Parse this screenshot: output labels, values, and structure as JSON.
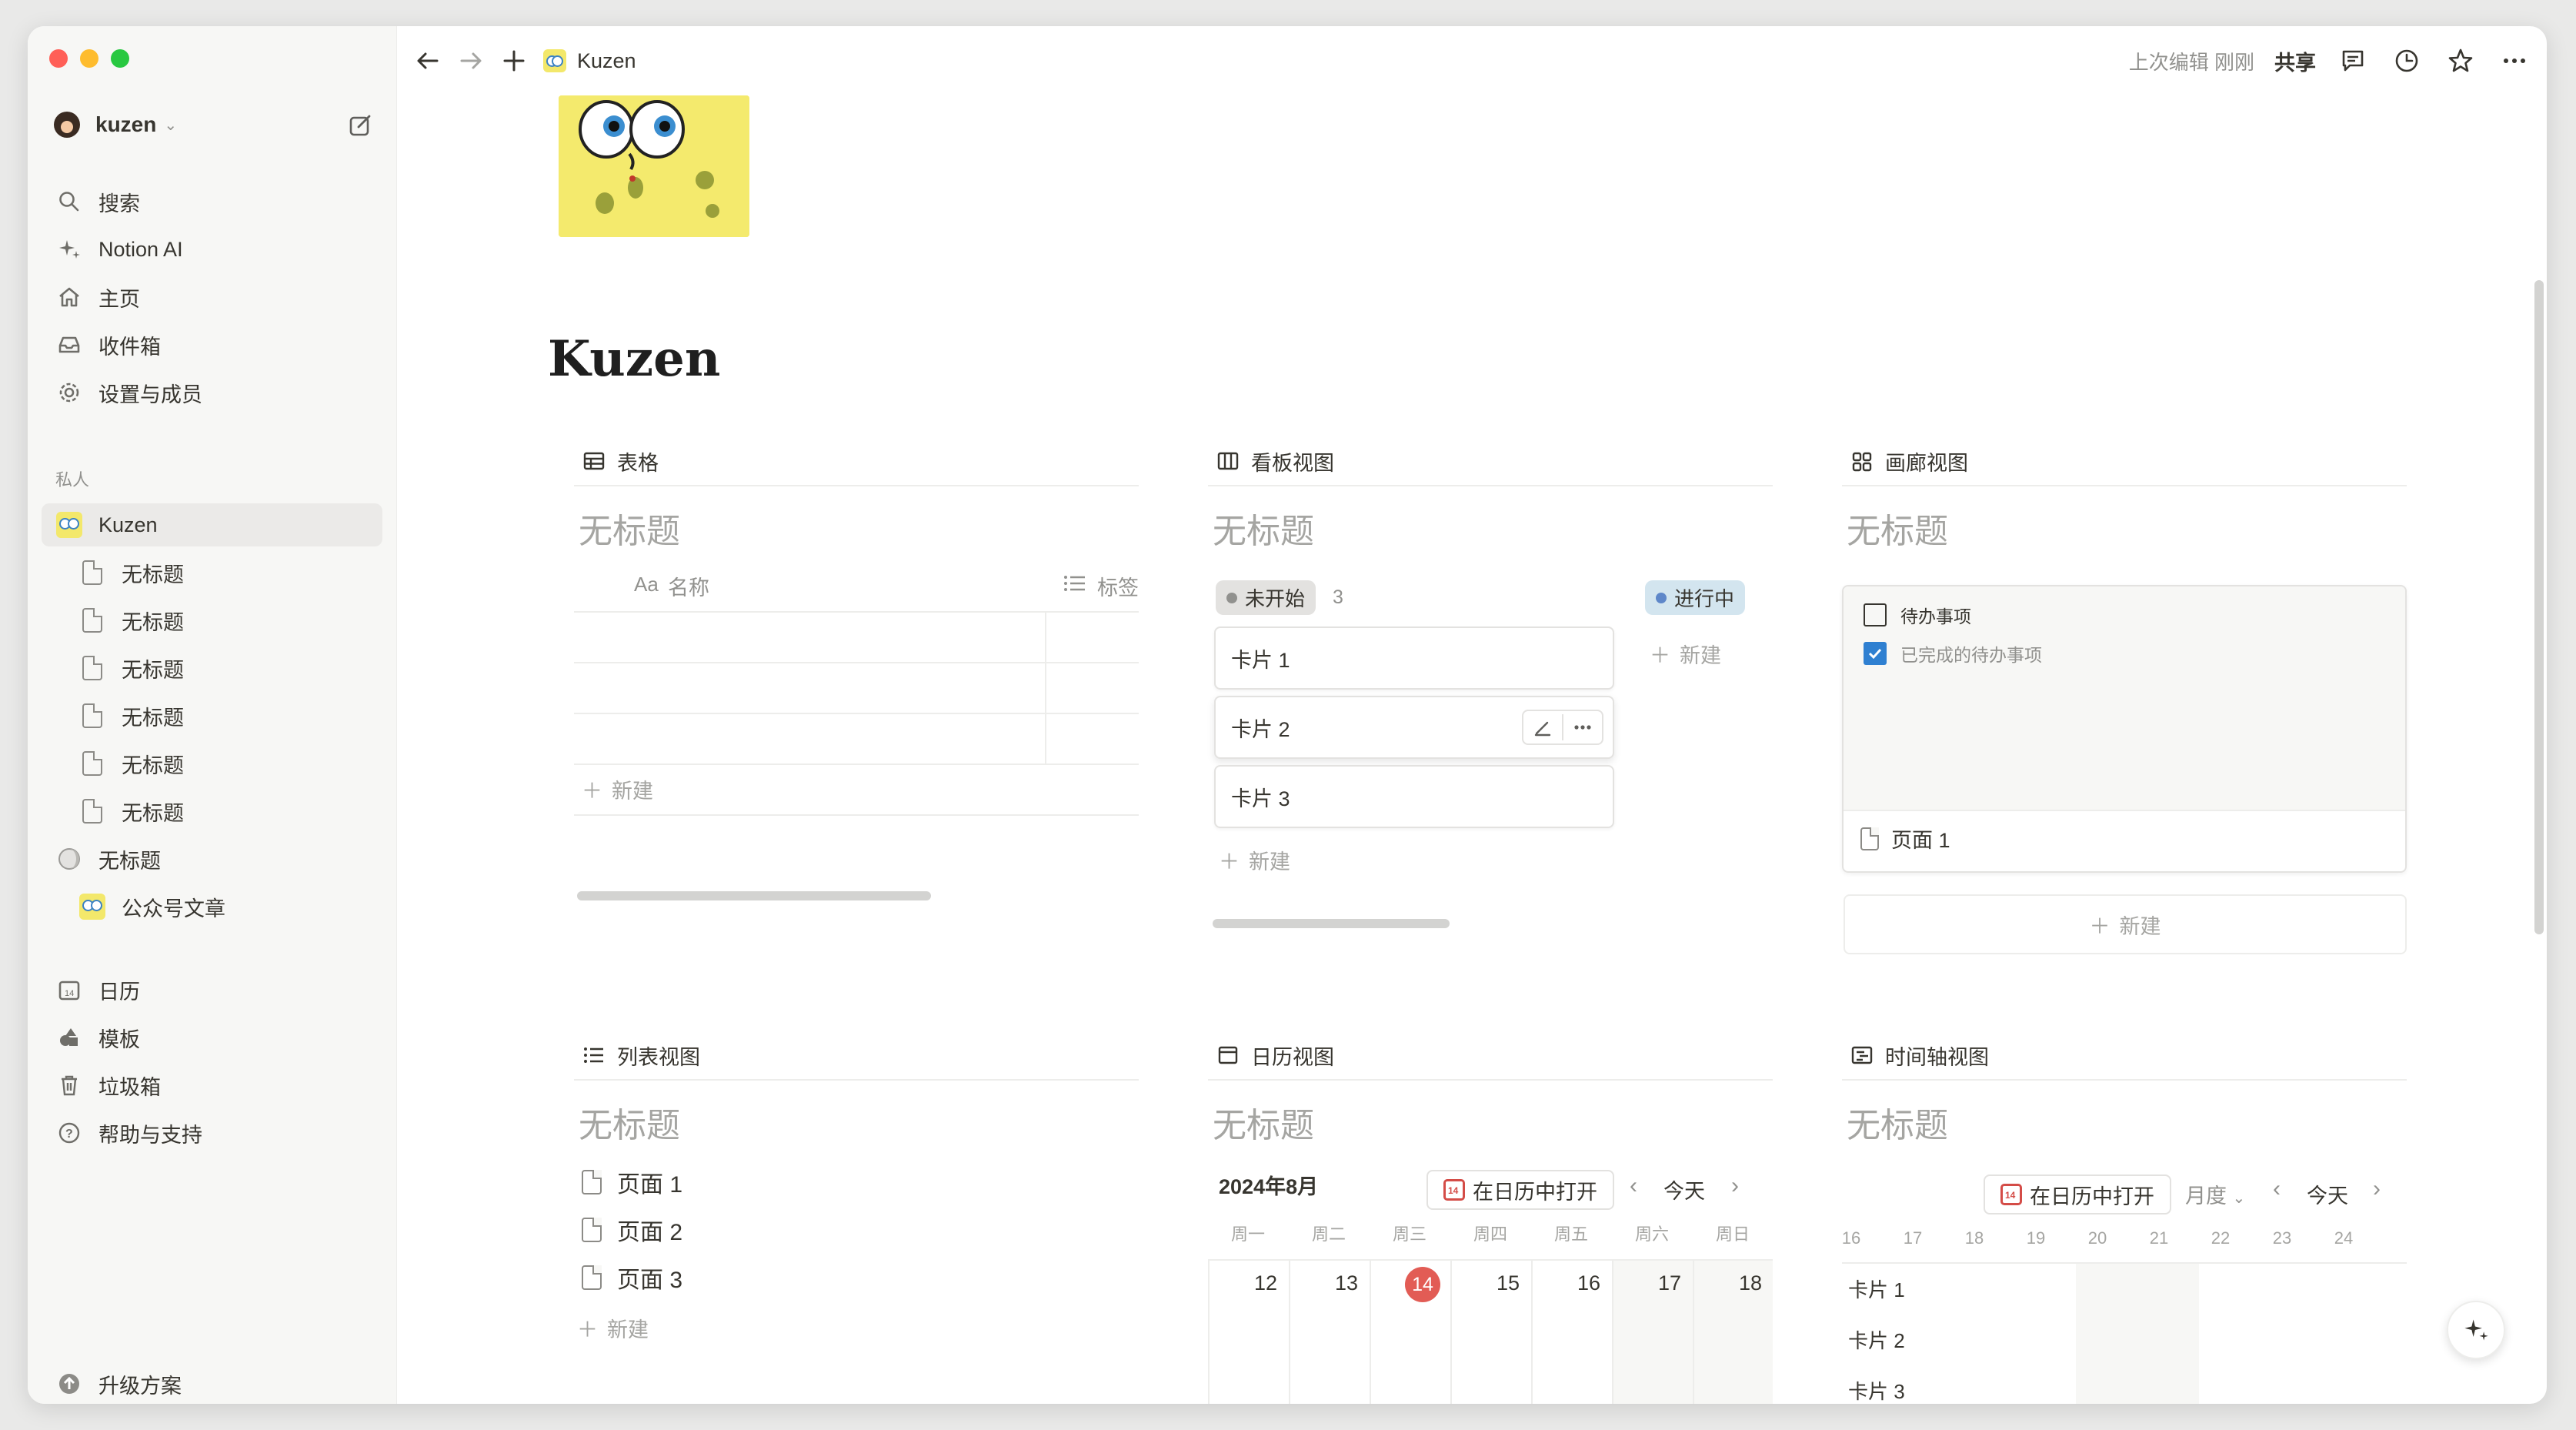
{
  "sidebar": {
    "workspace": "kuzen",
    "nav": [
      {
        "label": "搜索",
        "icon": "search-icon"
      },
      {
        "label": "Notion AI",
        "icon": "sparkle-icon"
      },
      {
        "label": "主页",
        "icon": "home-icon"
      },
      {
        "label": "收件箱",
        "icon": "inbox-icon"
      },
      {
        "label": "设置与成员",
        "icon": "gear-icon"
      }
    ],
    "private_label": "私人",
    "pages": [
      {
        "label": "Kuzen",
        "level": 0,
        "icon": "spongebob-icon",
        "active": true
      },
      {
        "label": "无标题",
        "level": 1,
        "icon": "page-icon"
      },
      {
        "label": "无标题",
        "level": 1,
        "icon": "page-icon"
      },
      {
        "label": "无标题",
        "level": 1,
        "icon": "page-icon"
      },
      {
        "label": "无标题",
        "level": 1,
        "icon": "page-icon"
      },
      {
        "label": "无标题",
        "level": 1,
        "icon": "page-icon"
      },
      {
        "label": "无标题",
        "level": 1,
        "icon": "page-icon"
      },
      {
        "label": "无标题",
        "level": 0,
        "icon": "moon-icon"
      },
      {
        "label": "公众号文章",
        "level": 1,
        "icon": "spongebob-icon"
      }
    ],
    "bottom": [
      {
        "label": "日历",
        "icon": "calendar-icon"
      },
      {
        "label": "模板",
        "icon": "shapes-icon"
      },
      {
        "label": "垃圾箱",
        "icon": "trash-icon"
      },
      {
        "label": "帮助与支持",
        "icon": "help-icon"
      }
    ],
    "upgrade": "升级方案"
  },
  "topbar": {
    "breadcrumb": "Kuzen",
    "edited": "上次编辑 刚刚",
    "share": "共享"
  },
  "page": {
    "title": "Kuzen"
  },
  "views": {
    "table": {
      "tab": "表格",
      "title": "无标题",
      "col_name_prefix": "Aa",
      "col_name": "名称",
      "col_tags": "标签",
      "new": "新建"
    },
    "board": {
      "tab": "看板视图",
      "title": "无标题",
      "groups": [
        {
          "label": "未开始",
          "count": "3",
          "color": "#91918e",
          "bg": "#e3e2e0"
        },
        {
          "label": "进行中",
          "count": "",
          "color": "#5e87c9",
          "bg": "#d3e5ef"
        }
      ],
      "cards": [
        "卡片 1",
        "卡片 2",
        "卡片 3"
      ],
      "new": "新建"
    },
    "gallery": {
      "tab": "画廊视图",
      "title": "无标题",
      "todo": "待办事项",
      "done": "已完成的待办事项",
      "card_title": "页面 1",
      "new": "新建"
    },
    "list": {
      "tab": "列表视图",
      "title": "无标题",
      "items": [
        "页面 1",
        "页面 2",
        "页面 3"
      ],
      "new": "新建"
    },
    "calendar": {
      "tab": "日历视图",
      "title": "无标题",
      "month": "2024年8月",
      "open_btn": "在日历中打开",
      "today": "今天",
      "weekdays": [
        "周一",
        "周二",
        "周三",
        "周四",
        "周五",
        "周六",
        "周日"
      ],
      "days": [
        "12",
        "13",
        "14",
        "15",
        "16",
        "17",
        "18"
      ],
      "today_day": "14"
    },
    "timeline": {
      "tab": "时间轴视图",
      "title": "无标题",
      "open_btn": "在日历中打开",
      "scale": "月度",
      "today": "今天",
      "days": [
        "16",
        "17",
        "18",
        "19",
        "20",
        "21",
        "22",
        "23",
        "24"
      ],
      "rows": [
        "卡片 1",
        "卡片 2",
        "卡片 3"
      ]
    }
  }
}
